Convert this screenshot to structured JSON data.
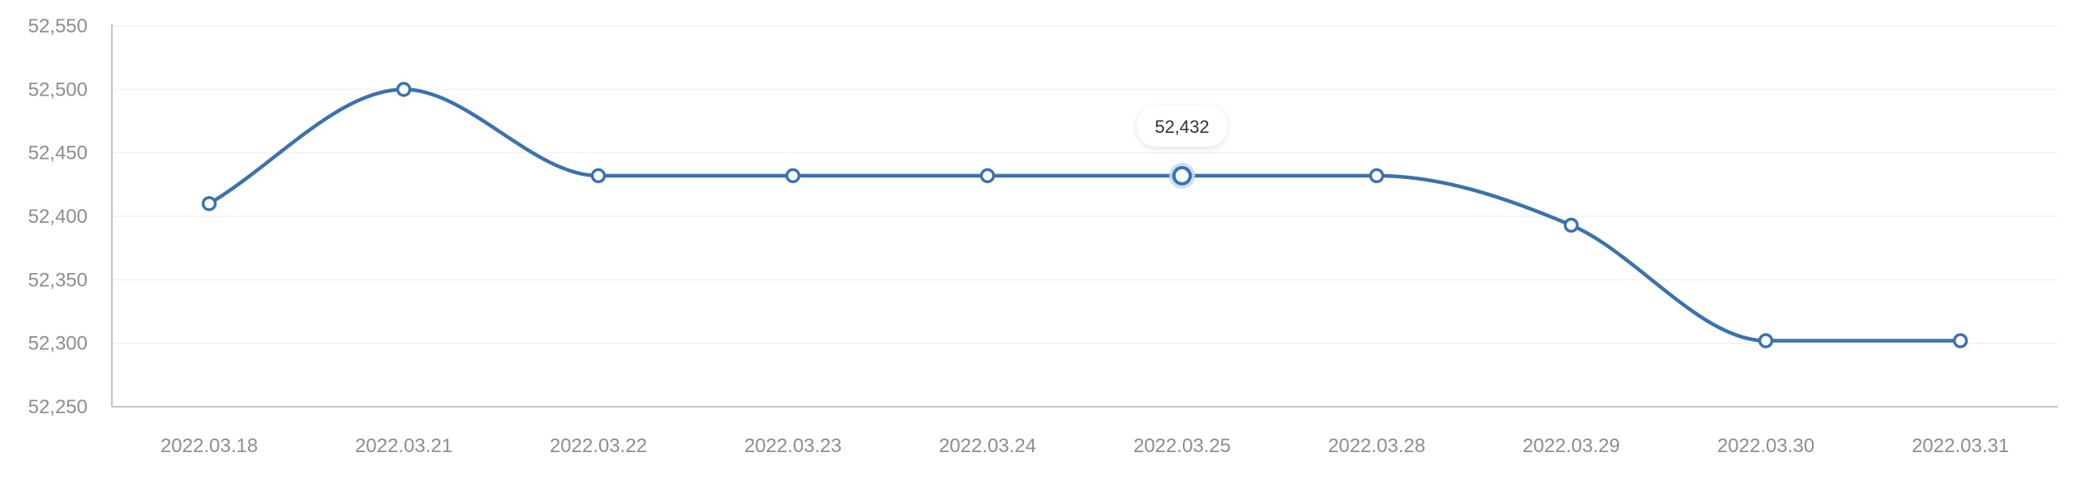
{
  "chart_data": {
    "type": "line",
    "categories": [
      "2022.03.18",
      "2022.03.21",
      "2022.03.22",
      "2022.03.23",
      "2022.03.24",
      "2022.03.25",
      "2022.03.28",
      "2022.03.29",
      "2022.03.30",
      "2022.03.31"
    ],
    "series": [
      {
        "values": [
          52410,
          52500,
          52432,
          52432,
          52432,
          52432,
          52432,
          52393,
          52302,
          52302
        ]
      }
    ],
    "yticks": [
      "52,250",
      "52,300",
      "52,350",
      "52,400",
      "52,450",
      "52,500",
      "52,550"
    ],
    "ylim": [
      52250,
      52550
    ],
    "grid": true,
    "smooth": true,
    "highlight_index": 5,
    "tooltip": "52,432",
    "colors": {
      "line": "#3a72ad",
      "marker_fill": "#ffffff",
      "highlight_halo": "#c7d9ee",
      "grid": "#f1f1f1",
      "axis": "#b0b0b0",
      "tick_text": "#8a8d93"
    }
  }
}
